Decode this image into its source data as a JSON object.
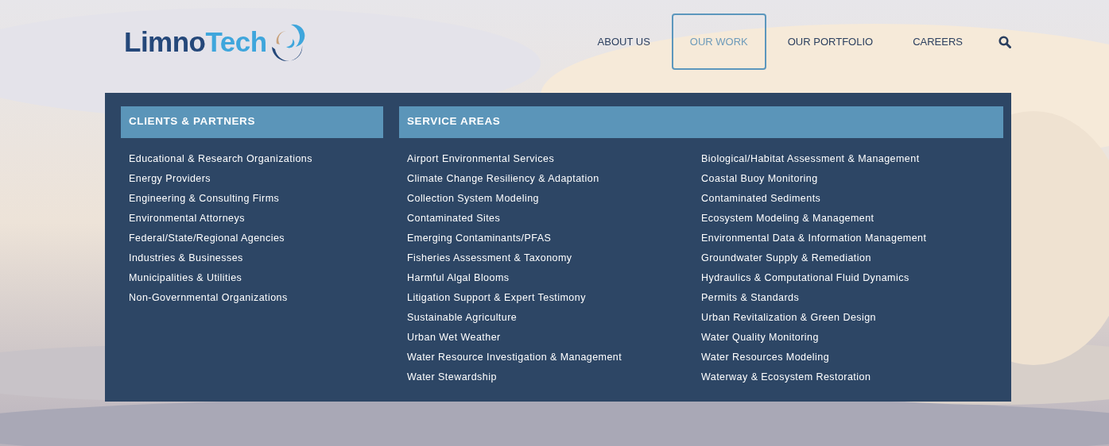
{
  "logo": {
    "first_part": "Limno",
    "second_part": "Tech"
  },
  "nav": [
    {
      "label": "ABOUT US",
      "selected": false
    },
    {
      "label": "OUR WORK",
      "selected": true
    },
    {
      "label": "OUR PORTFOLIO",
      "selected": false
    },
    {
      "label": "CAREERS",
      "selected": false
    }
  ],
  "mega_menu": {
    "sections": [
      {
        "title": "CLIENTS & PARTNERS",
        "columns": [
          [
            "Educational & Research Organizations",
            "Energy Providers",
            "Engineering & Consulting Firms",
            "Environmental Attorneys",
            "Federal/State/Regional Agencies",
            "Industries & Businesses",
            "Municipalities & Utilities",
            "Non-Governmental Organizations"
          ]
        ]
      },
      {
        "title": "SERVICE AREAS",
        "columns": [
          [
            "Airport Environmental Services",
            "Climate Change Resiliency & Adaptation",
            "Collection System Modeling",
            "Contaminated Sites",
            "Emerging Contaminants/PFAS",
            "Fisheries Assessment & Taxonomy",
            "Harmful Algal Blooms",
            "Litigation Support & Expert Testimony",
            "Sustainable Agriculture",
            "Urban Wet Weather",
            "Water Resource Investigation & Management",
            "Water Stewardship"
          ],
          [
            "Biological/Habitat Assessment & Management",
            "Coastal Buoy Monitoring",
            "Contaminated Sediments",
            "Ecosystem Modeling & Management",
            "Environmental Data & Information Management",
            "Groundwater Supply & Remediation",
            "Hydraulics & Computational Fluid Dynamics",
            "Permits & Standards",
            "Urban Revitalization & Green Design",
            "Water Quality Monitoring",
            "Water Resources Modeling",
            "Waterway & Ecosystem Restoration"
          ]
        ]
      }
    ]
  }
}
